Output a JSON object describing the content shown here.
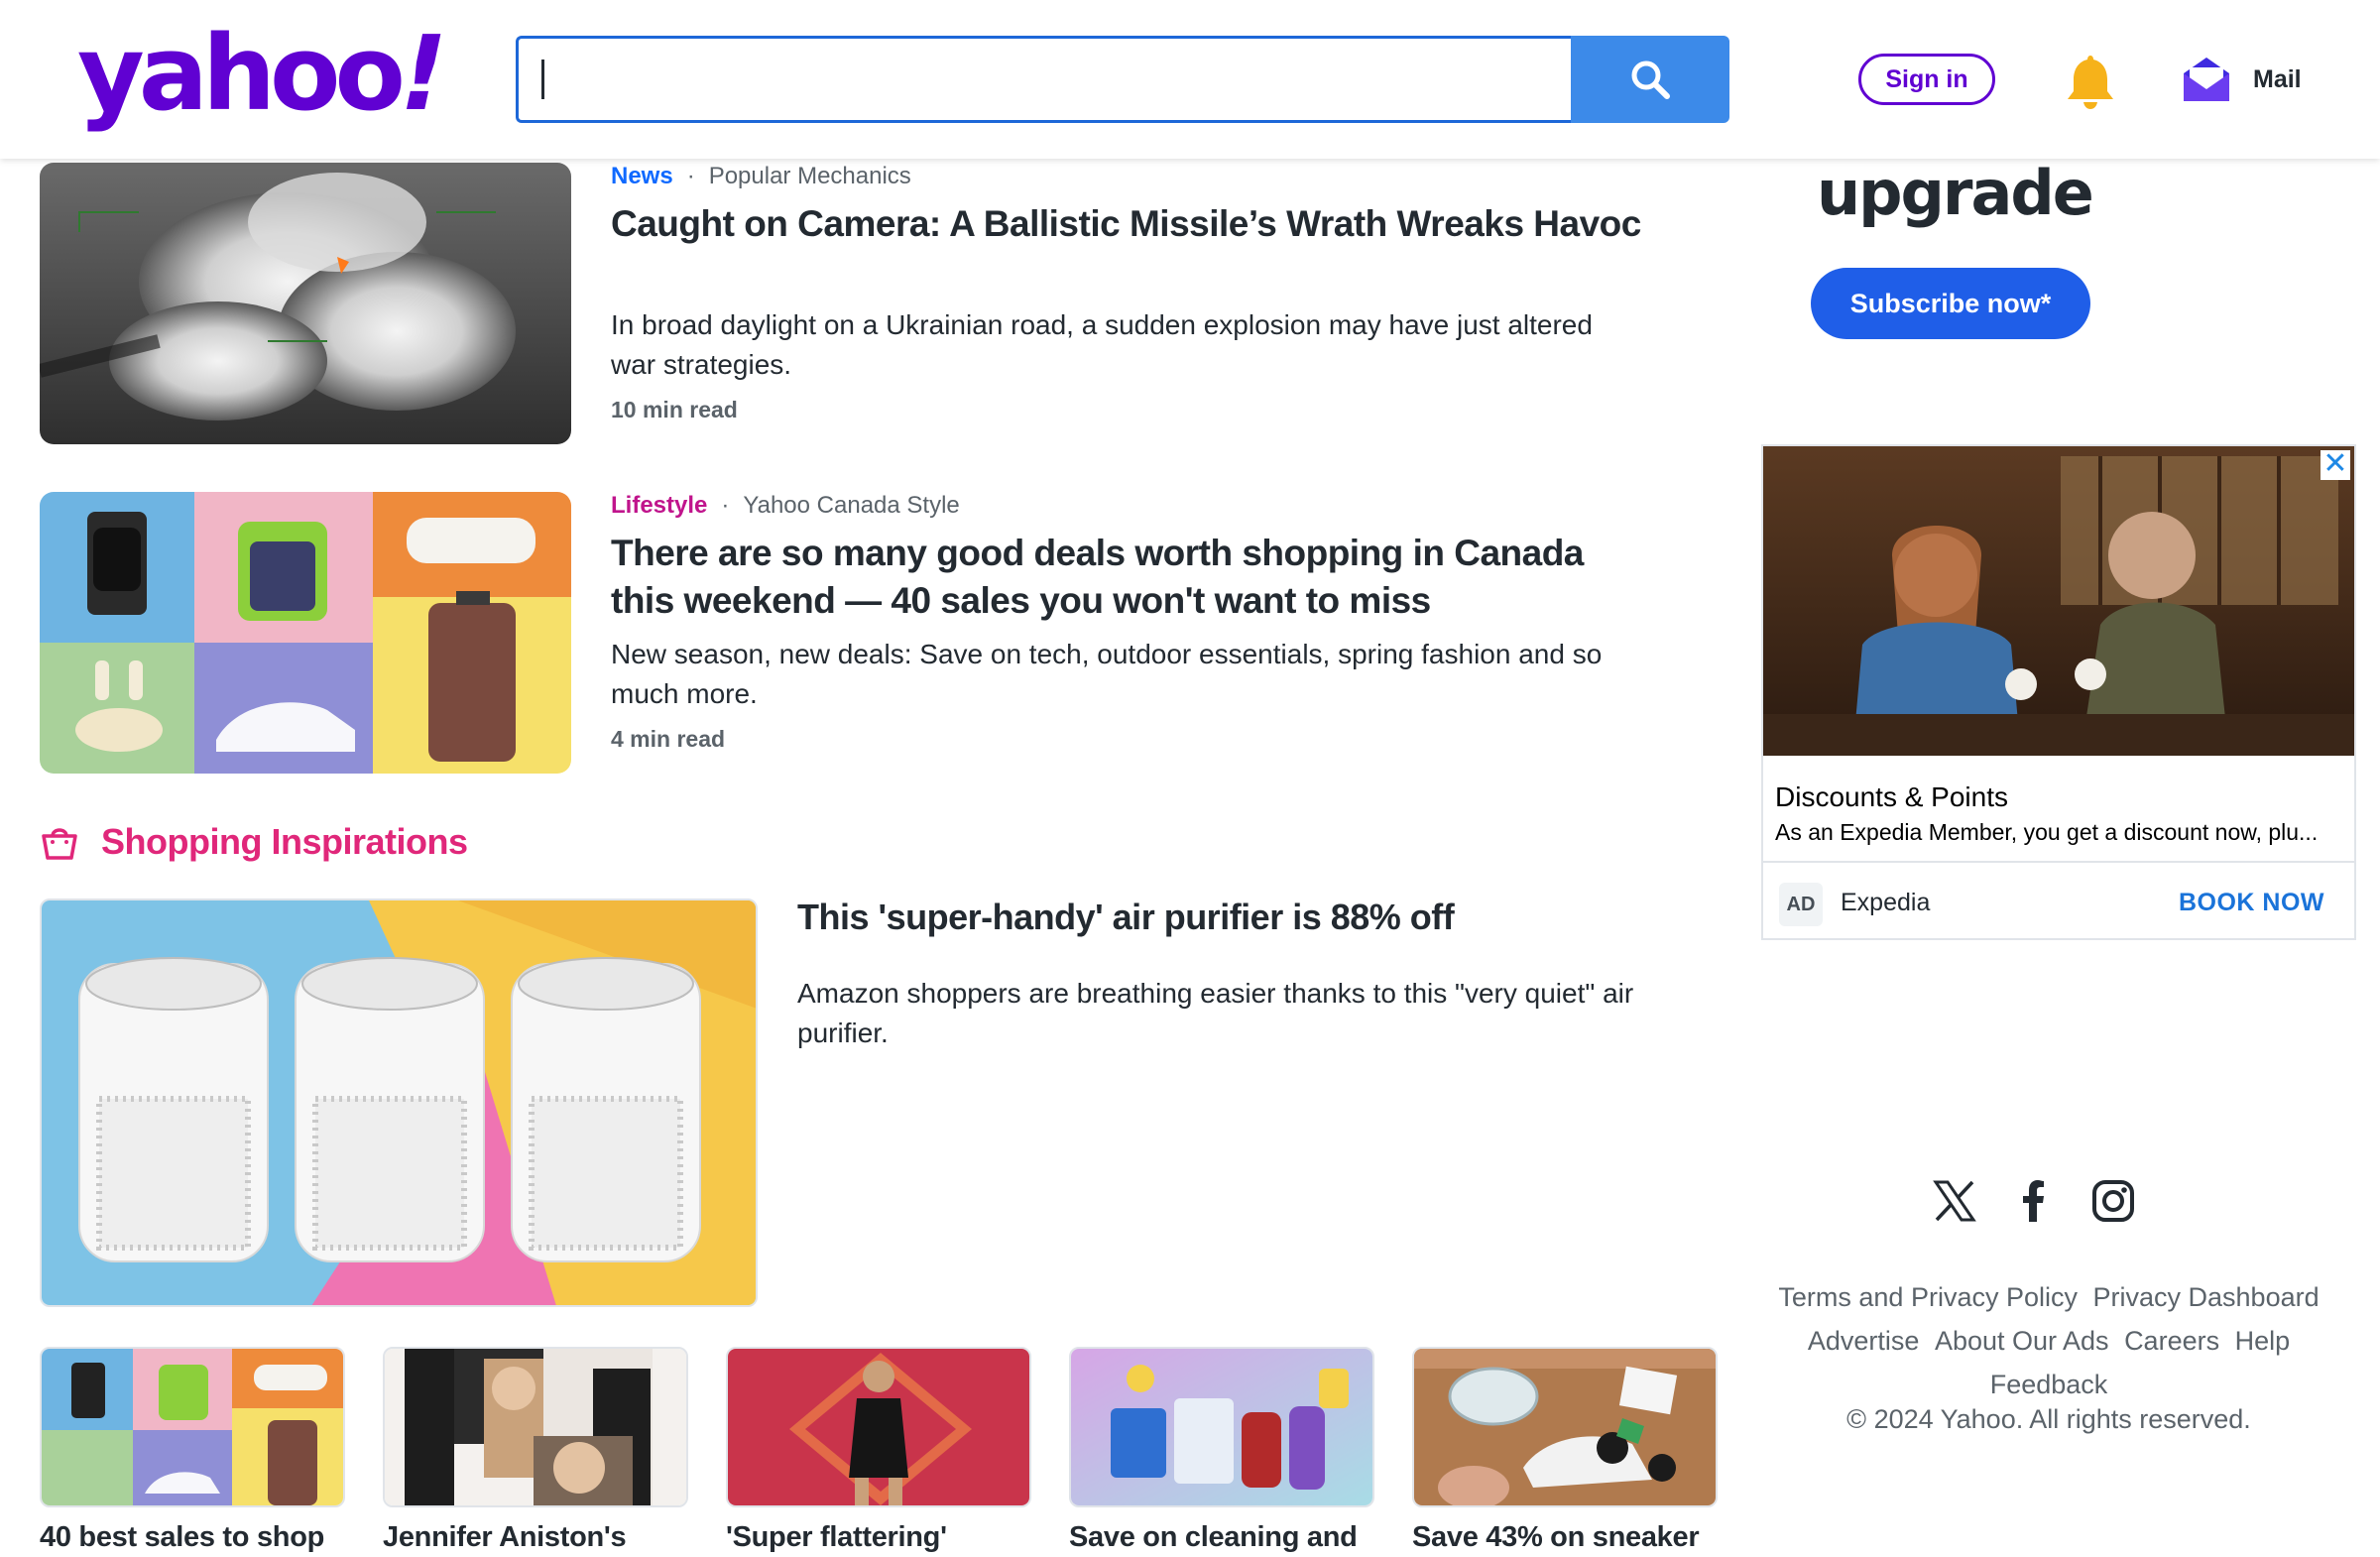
{
  "header": {
    "logo": "yahoo!",
    "search": {
      "value": "",
      "placeholder": ""
    },
    "sign_in": "Sign in",
    "mail": "Mail"
  },
  "articles": [
    {
      "category": "News",
      "category_color": "#0f69ff",
      "source": "Popular Mechanics",
      "headline": "Caught on Camera: A Ballistic Missile’s Wrath Wreaks Havoc",
      "summary": "In broad daylight on a Ukrainian road, a sudden explosion may have just altered war strategies.",
      "read_time": "10 min read"
    },
    {
      "category": "Lifestyle",
      "category_color": "#c0148c",
      "source": "Yahoo Canada Style",
      "headline": "There are so many good deals worth shopping in Canada this weekend — 40 sales you won't want to miss",
      "summary": "New season, new deals: Save on tech, outdoor essentials, spring fashion and so much more.",
      "read_time": "4 min read"
    }
  ],
  "shopping": {
    "title": "Shopping Inspirations",
    "feature": {
      "headline": "This 'super-handy' air purifier is 88% off",
      "summary": "Amazon shoppers are breathing easier thanks to this \"very quiet\" air purifier."
    },
    "tiles": [
      {
        "label": "40 best sales to shop"
      },
      {
        "label": "Jennifer Aniston's"
      },
      {
        "label": "'Super flattering'"
      },
      {
        "label": "Save on cleaning and"
      },
      {
        "label": "Save 43% on sneaker"
      }
    ]
  },
  "sidebar": {
    "promo_word": "upgrade",
    "subscribe": "Subscribe now*",
    "ad": {
      "close": "✕",
      "title": "Discounts & Points",
      "description": "As an Expedia Member, you get a discount now, plu...",
      "badge": "AD",
      "brand": "Expedia",
      "cta": "BOOK NOW"
    },
    "socials": [
      "x-icon",
      "facebook-icon",
      "instagram-icon"
    ],
    "footer_links": [
      "Terms and Privacy Policy",
      "Privacy Dashboard",
      "Advertise",
      "About Our Ads",
      "Careers",
      "Help",
      "Feedback"
    ],
    "copyright": "© 2024 Yahoo. All rights reserved."
  },
  "colors": {
    "brand_purple": "#6001d2",
    "search_blue": "#3c8ae9",
    "shopping_pink": "#e0277a",
    "subscribe_blue": "#1f5ee8"
  }
}
